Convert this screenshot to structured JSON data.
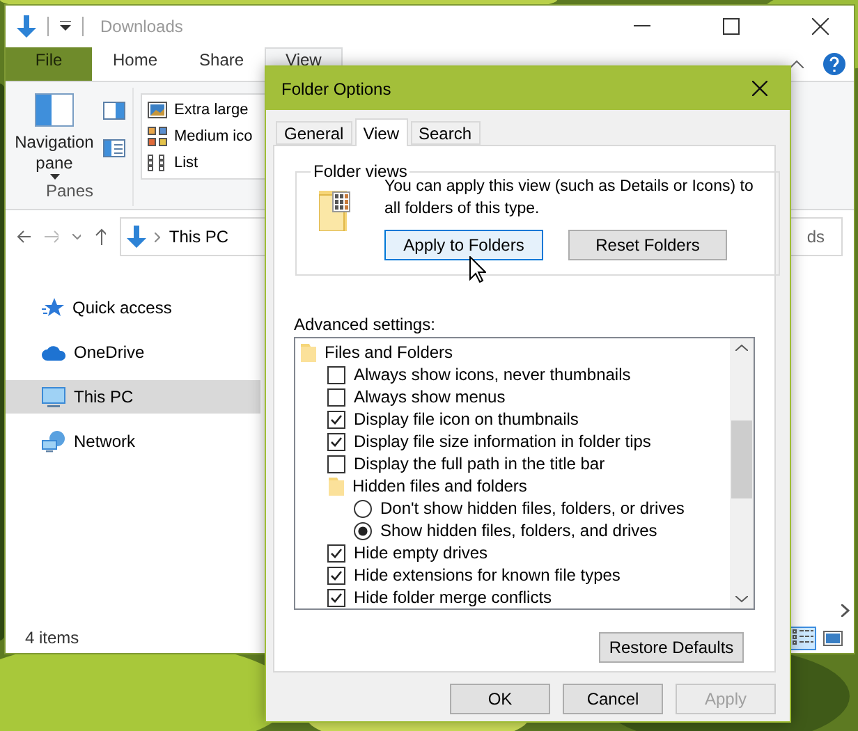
{
  "explorer": {
    "title": "Downloads",
    "ribbon_tabs": [
      {
        "label": "File",
        "kind": "file",
        "selected": false
      },
      {
        "label": "Home",
        "kind": "tab",
        "selected": false
      },
      {
        "label": "Share",
        "kind": "tab",
        "selected": false
      },
      {
        "label": "View",
        "kind": "tab",
        "selected": true
      }
    ],
    "panes_group": {
      "button": "Navigation pane",
      "label": "Panes"
    },
    "layout_options": [
      {
        "label": "Extra large",
        "kind": "xl"
      },
      {
        "label": "Medium ico",
        "kind": "medium"
      },
      {
        "label": "List",
        "kind": "list"
      }
    ],
    "address": {
      "crumb": "This PC"
    },
    "search": {
      "placeholder": "ds"
    },
    "nav_items": [
      {
        "label": "Quick access",
        "kind": "star",
        "selected": false
      },
      {
        "label": "OneDrive",
        "kind": "cloud",
        "selected": false
      },
      {
        "label": "This PC",
        "kind": "pc",
        "selected": true
      },
      {
        "label": "Network",
        "kind": "network",
        "selected": false
      }
    ],
    "status_bar": "4 items",
    "view_toggles": [
      {
        "kind": "details",
        "selected": true
      },
      {
        "kind": "large",
        "selected": false
      }
    ]
  },
  "dialog": {
    "title": "Folder Options",
    "tabs": [
      {
        "label": "General",
        "selected": false
      },
      {
        "label": "View",
        "selected": true
      },
      {
        "label": "Search",
        "selected": false
      }
    ],
    "folder_views": {
      "title": "Folder views",
      "description": "You can apply this view (such as Details or Icons) to all folders of this type.",
      "buttons": [
        {
          "label": "Apply to Folders",
          "hovered": true
        },
        {
          "label": "Reset Folders",
          "hovered": false
        }
      ]
    },
    "advanced_label": "Advanced settings:",
    "settings": [
      {
        "kind": "folder",
        "label": "Files and Folders",
        "children": [
          {
            "kind": "checkbox",
            "label": "Always show icons, never thumbnails",
            "checked": false
          },
          {
            "kind": "checkbox",
            "label": "Always show menus",
            "checked": false
          },
          {
            "kind": "checkbox",
            "label": "Display file icon on thumbnails",
            "checked": true
          },
          {
            "kind": "checkbox",
            "label": "Display file size information in folder tips",
            "checked": true
          },
          {
            "kind": "checkbox",
            "label": "Display the full path in the title bar",
            "checked": false
          },
          {
            "kind": "folder",
            "label": "Hidden files and folders",
            "children": [
              {
                "kind": "radio",
                "label": "Don't show hidden files, folders, or drives",
                "checked": false
              },
              {
                "kind": "radio",
                "label": "Show hidden files, folders, and drives",
                "checked": true
              }
            ]
          },
          {
            "kind": "checkbox",
            "label": "Hide empty drives",
            "checked": true
          },
          {
            "kind": "checkbox",
            "label": "Hide extensions for known file types",
            "checked": true
          },
          {
            "kind": "checkbox",
            "label": "Hide folder merge conflicts",
            "checked": true
          }
        ]
      }
    ],
    "restore_button": "Restore Defaults",
    "buttons": [
      {
        "label": "OK",
        "disabled": false
      },
      {
        "label": "Cancel",
        "disabled": false
      },
      {
        "label": "Apply",
        "disabled": true
      }
    ]
  }
}
